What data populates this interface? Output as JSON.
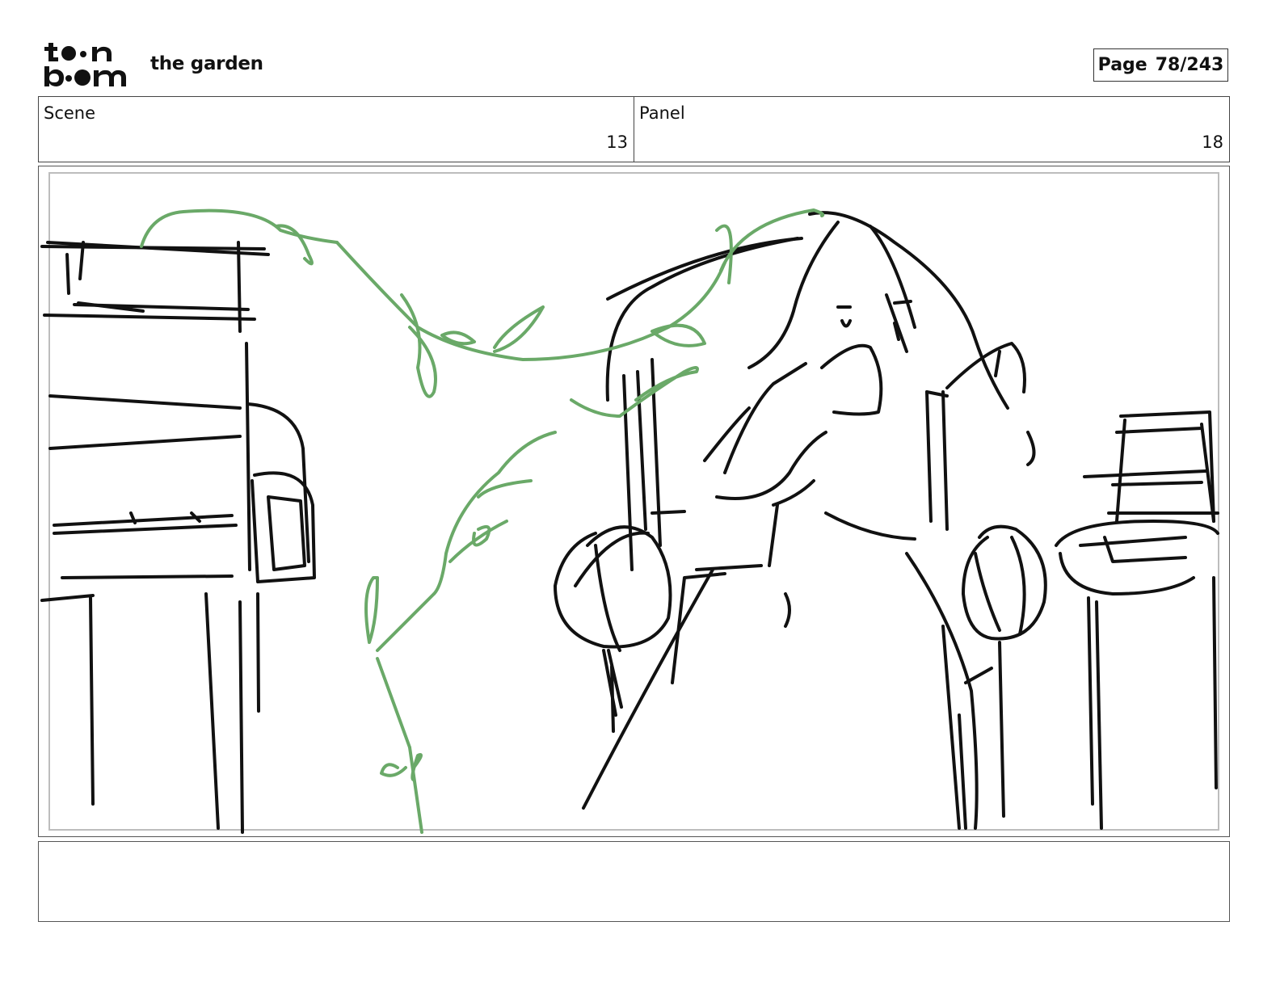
{
  "header": {
    "logo_text": "toon boom",
    "project_title": "the garden",
    "page_label": "Page",
    "page_value": "78/243"
  },
  "info": {
    "scene_label": "Scene",
    "scene_value": "13",
    "panel_label": "Panel",
    "panel_value": "18"
  },
  "sketch": {
    "line_color": "#111111",
    "vine_color": "#6aa968"
  },
  "notes": {
    "text": ""
  }
}
